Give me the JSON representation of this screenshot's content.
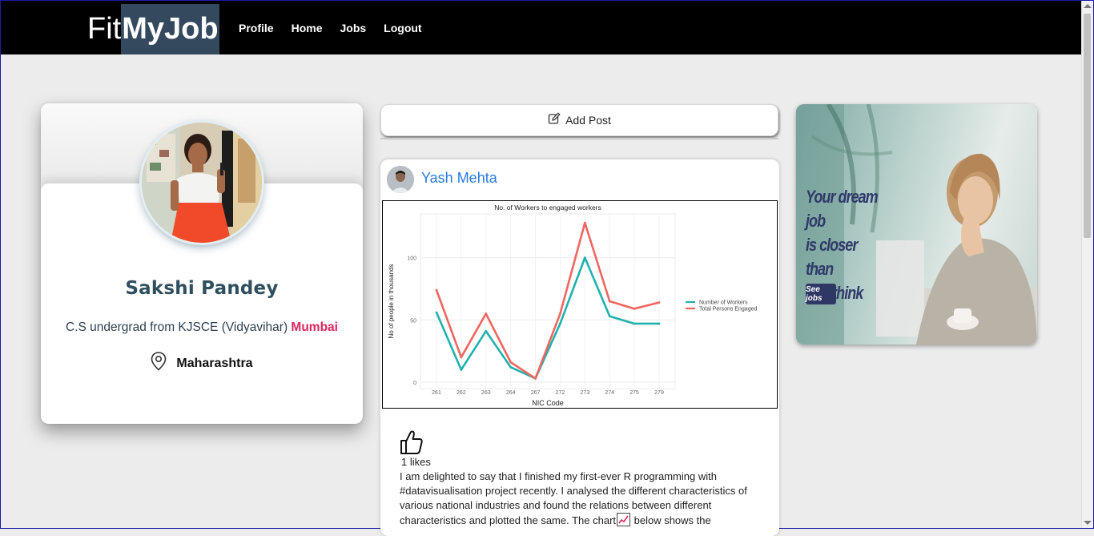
{
  "brand": {
    "prefix": "Fit",
    "highlight": "MyJob"
  },
  "nav": {
    "profile": "Profile",
    "home": "Home",
    "jobs": "Jobs",
    "logout": "Logout"
  },
  "profile": {
    "name": "Sakshi Pandey",
    "description": "C.S undergrad from KJSCE (Vidyavihar)",
    "city": "Mumbai",
    "state": "Maharashtra"
  },
  "add_post": {
    "label": "Add Post"
  },
  "post": {
    "author": "Yash Mehta",
    "likes": "1 likes",
    "text_part1": "I am delighted to say that I finished my first-ever R programming with #datavisualisation project recently. I analysed the different characteristics of various national industries and found the relations between different characteristics and plotted the same. The chart",
    "text_part2": " below shows the"
  },
  "chart_data": {
    "type": "line",
    "title": "No. of Workers to engaged workers",
    "xlabel": "NIC Code",
    "ylabel": "No of people in thousands",
    "categories": [
      "261",
      "262",
      "263",
      "264",
      "267",
      "272",
      "273",
      "274",
      "275",
      "279"
    ],
    "yticks": [
      "0",
      "50",
      "100"
    ],
    "ylim": [
      0,
      130
    ],
    "series": [
      {
        "name": "Number of Workers",
        "color": "#21b1ad",
        "values": [
          56,
          10,
          41,
          12,
          3,
          47,
          100,
          53,
          47,
          47
        ]
      },
      {
        "name": "Total Persons Engaged",
        "color": "#ee6660",
        "values": [
          74,
          20,
          55,
          16,
          3,
          55,
          128,
          65,
          59,
          64
        ]
      }
    ],
    "legend": "right",
    "grid": true
  },
  "ad": {
    "line1": "Your dream job",
    "line2": "is closer than",
    "line3": "you think",
    "button": "See jobs"
  }
}
